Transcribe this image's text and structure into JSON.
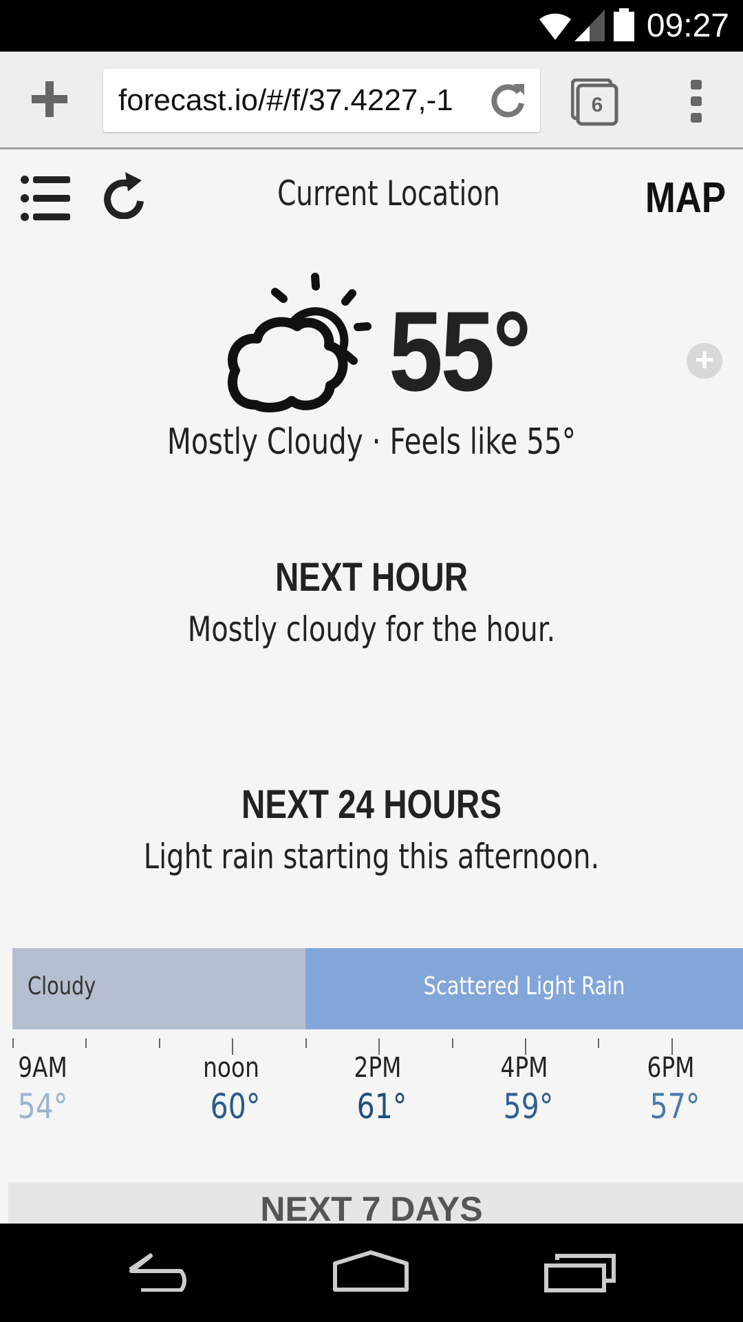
{
  "status_bar": {
    "time": "09:27",
    "icons": [
      "wifi-icon",
      "signal-icon",
      "battery-icon"
    ]
  },
  "browser": {
    "url": "forecast.io/#/f/37.4227,-1",
    "tab_count": "6",
    "icons": [
      "plus-icon",
      "reload-icon",
      "tabs-icon",
      "overflow-menu-icon"
    ]
  },
  "app_header": {
    "location": "Current Location",
    "map_label": "MAP",
    "icons": [
      "menu-list-icon",
      "refresh-icon"
    ]
  },
  "current": {
    "temperature": "55°",
    "summary": "Mostly Cloudy · Feels like 55°",
    "icon": "partly-cloudy-icon",
    "add_label": "+"
  },
  "next_hour": {
    "heading": "NEXT HOUR",
    "text": "Mostly cloudy for the hour."
  },
  "next_24_hours": {
    "heading": "NEXT 24 HOURS",
    "text": "Light rain starting this afternoon."
  },
  "timeline": {
    "segments": [
      {
        "label": "Cloudy",
        "color": "#b6bfd0"
      },
      {
        "label": "Scattered Light Rain",
        "color": "#82a6d9"
      }
    ],
    "hours": [
      {
        "time": "9AM",
        "temp": "54°",
        "color": "#9ab3cf"
      },
      {
        "time": "noon",
        "temp": "60°",
        "color": "#2a5a8a"
      },
      {
        "time": "2PM",
        "temp": "61°",
        "color": "#1f4e7e"
      },
      {
        "time": "4PM",
        "temp": "59°",
        "color": "#2f5f8f"
      },
      {
        "time": "6PM",
        "temp": "57°",
        "color": "#4a7aa8"
      }
    ]
  },
  "next_7_days": {
    "heading": "NEXT 7 DAYS"
  },
  "nav_bar": {
    "icons": [
      "back-icon",
      "home-icon",
      "recents-icon"
    ]
  }
}
